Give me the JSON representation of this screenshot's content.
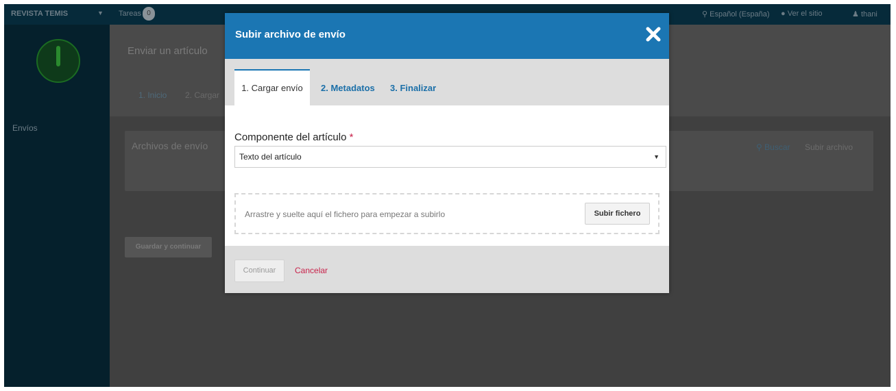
{
  "topbar": {
    "brand": "REVISTA TEMIS",
    "caret": "▼",
    "tasks_label": "Tareas",
    "tasks_count": "0",
    "language": "Español (España)",
    "view_site": "Ver el sitio",
    "user": "thani"
  },
  "sidebar": {
    "envios": "Envíos"
  },
  "main": {
    "title": "Enviar un artículo",
    "steps": [
      "1. Inicio",
      "2. Cargar"
    ],
    "files_panel_title": "Archivos de envío",
    "buscar": "Buscar",
    "subir_archivo": "Subir archivo",
    "save_continue": "Guardar y continuar"
  },
  "modal": {
    "title": "Subir archivo de envío",
    "tabs": [
      "1. Cargar envío",
      "2. Metadatos",
      "3. Finalizar"
    ],
    "field_label": "Componente del artículo",
    "required_mark": "*",
    "select_value": "Texto del artículo",
    "dropzone_text": "Arrastre y suelte aquí el fichero para empezar a subirlo",
    "upload_button": "Subir fichero",
    "continue_button": "Continuar",
    "cancel_link": "Cancelar"
  },
  "colors": {
    "modal_header": "#1b76b3",
    "required": "#c8234b",
    "overlay": "#404040",
    "sidebar": "#05202c"
  },
  "icons": {
    "close": "close-icon",
    "search": "search-icon",
    "globe": "globe-icon",
    "eye": "eye-icon",
    "user": "user-icon",
    "select_arrow": "chevron-down-icon"
  }
}
